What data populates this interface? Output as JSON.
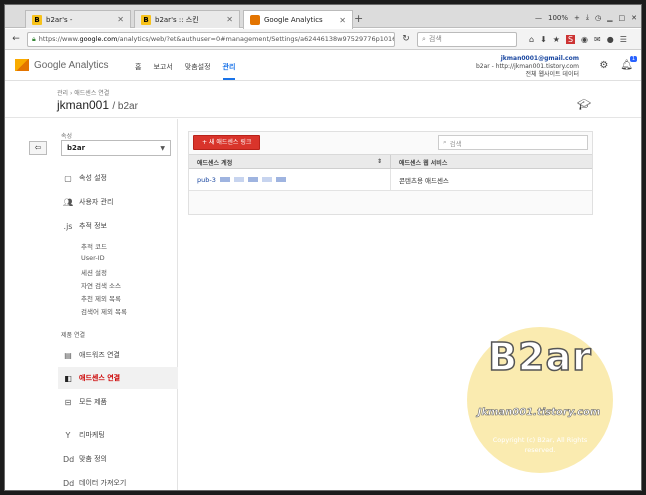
{
  "browser": {
    "tabs": [
      {
        "label": "b2ar's -",
        "favicon": "B"
      },
      {
        "label": "b2ar's :: 스킨",
        "favicon": "B"
      },
      {
        "label": "Google Analytics",
        "favicon": "ga"
      }
    ],
    "new_tab_glyph": "+",
    "zoom": "100%",
    "url_prefix": "https://www.",
    "url_host": "google.com",
    "url_rest": "/analytics/web/?et&authuser=0#management/Settings/a62446138w97529776p101641867/%3Fr",
    "search_placeholder": "검색"
  },
  "ga": {
    "logo_text": "Google Analytics",
    "nav": [
      {
        "label": "홈"
      },
      {
        "label": "보고서"
      },
      {
        "label": "맞춤설정"
      },
      {
        "label": "관리",
        "active": true
      }
    ],
    "account_email": "jkman0001@gmail.com",
    "account_line2": "b2ar - http://jkman001.tistory.com",
    "account_line3": "전체 웹사이트 데이터",
    "notification_count": "1"
  },
  "page": {
    "breadcrumb": "관리 › 애드센스 연결",
    "title": "jkman001",
    "title_sub": "/ b2ar"
  },
  "sidebar": {
    "property_label": "속성",
    "property_value": "b2ar",
    "items": [
      {
        "icon": "square",
        "label": "속성 설정"
      },
      {
        "icon": "people",
        "label": "사용자 관리"
      },
      {
        "icon": ".js",
        "label": "추적 정보"
      }
    ],
    "sub_items": [
      "추적 코드",
      "User-ID",
      "세션 설정",
      "자연 검색 소스",
      "추천 제외 목록",
      "검색어 제외 목록"
    ],
    "group_label": "제품 연결",
    "product_items": [
      {
        "icon": "adwords",
        "label": "애드워즈 연결"
      },
      {
        "icon": "adsense",
        "label": "애드센스 연결",
        "active": true
      },
      {
        "icon": "allproducts",
        "label": "모든 제품"
      }
    ],
    "other_items": [
      {
        "icon": "Y",
        "label": "리마케팅"
      },
      {
        "icon": "Dd",
        "label": "맞춤 정의"
      },
      {
        "icon": "Dd",
        "label": "데이터 가져오기"
      }
    ]
  },
  "content": {
    "add_button": "+ 새 애드센스 링크",
    "search_placeholder": "검색",
    "columns": [
      "애드센스 계정",
      "애드센스 웹 서비스"
    ],
    "rows": [
      {
        "account": "pub-3",
        "service": "콘텐츠용 애드센스"
      }
    ]
  },
  "watermark": {
    "big": "B2ar",
    "site": "Jkman001.tistory.com",
    "copy1": "Copyright (c) B2ar, All Rights",
    "copy2": "reserved."
  },
  "colors": {
    "accent": "#1a73e8",
    "add_button": "#d9342b",
    "active_item": "#cc0000"
  }
}
